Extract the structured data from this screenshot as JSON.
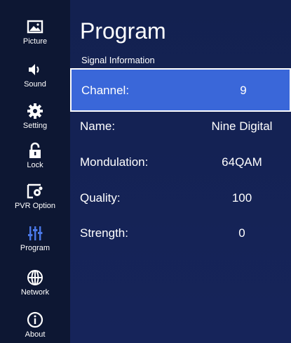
{
  "sidebar": {
    "items": [
      {
        "label": "Picture",
        "icon": "picture-icon"
      },
      {
        "label": "Sound",
        "icon": "speaker-icon"
      },
      {
        "label": "Setting",
        "icon": "gear-icon"
      },
      {
        "label": "Lock",
        "icon": "lock-icon"
      },
      {
        "label": "PVR Option",
        "icon": "record-settings-icon"
      },
      {
        "label": "Program",
        "icon": "sliders-icon"
      },
      {
        "label": "Network",
        "icon": "globe-icon"
      },
      {
        "label": "About",
        "icon": "info-icon"
      }
    ],
    "active": "Program"
  },
  "main": {
    "title": "Program",
    "subtitle": "Signal Information",
    "rows": [
      {
        "label": "Channel:",
        "value": "9",
        "selected": true
      },
      {
        "label": "Name:",
        "value": "Nine Digital"
      },
      {
        "label": "Mondulation:",
        "value": "64QAM"
      },
      {
        "label": "Quality:",
        "value": "100"
      },
      {
        "label": "Strength:",
        "value": "0"
      }
    ]
  },
  "colors": {
    "background": "#132150",
    "sidebar": "#0d1733",
    "highlight": "#3a67d9",
    "active_icon": "#4a78e8"
  }
}
